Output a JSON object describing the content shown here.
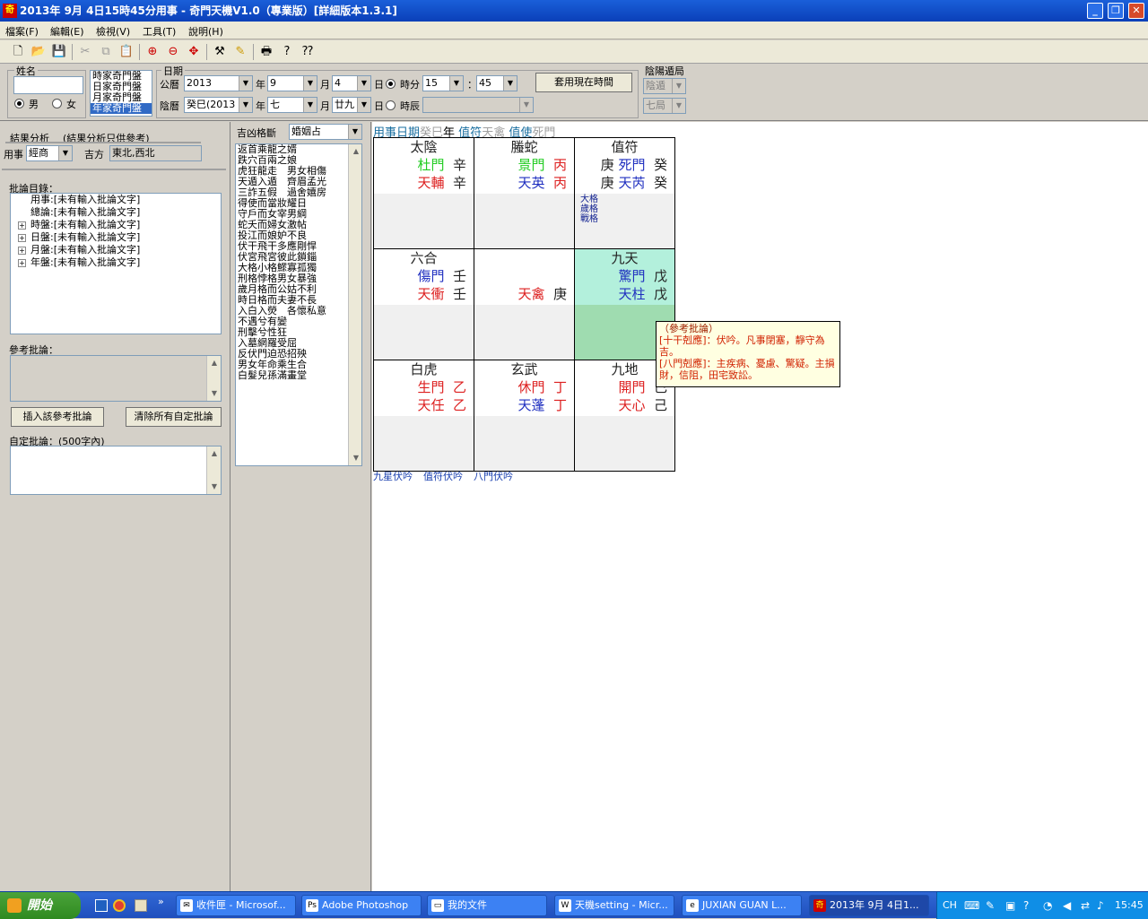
{
  "window": {
    "title": "2013年 9月 4日15時45分用事 - 奇門天機V1.0（專業版）[詳細版本1.3.1]",
    "icon": "qimen-app-icon",
    "minimize": "_",
    "restore": "❐",
    "close": "✕"
  },
  "menu": [
    {
      "label": "檔案(F)"
    },
    {
      "label": "編輯(E)"
    },
    {
      "label": "檢視(V)"
    },
    {
      "label": "工具(T)"
    },
    {
      "label": "說明(H)"
    }
  ],
  "toolbar": {
    "icons": [
      "new-file-icon",
      "open-folder-icon",
      "save-icon",
      "cut-icon",
      "copy-icon",
      "paste-icon",
      "zoom-in-icon",
      "zoom-out-icon",
      "compass-icon",
      "tool-icon",
      "highlight-icon",
      "print-icon",
      "help-icon",
      "context-help-icon"
    ]
  },
  "form": {
    "name_label": "姓名",
    "name_value": "",
    "male": "男",
    "female": "女",
    "chart_types": [
      "時家奇門盤",
      "日家奇門盤",
      "月家奇門盤",
      "年家奇門盤"
    ],
    "date_label": "日期",
    "solar_label": "公曆",
    "solar_year": "2013",
    "year_unit": "年",
    "solar_month": "9",
    "month_unit": "月",
    "solar_day": "4",
    "day_unit": "日",
    "hourmin_label": "時分",
    "hour": "15",
    "colon": "：",
    "minute": "45",
    "lunar_label": "陰曆",
    "lunar_year": "癸巳(2013",
    "lunar_month": "七",
    "lunar_day": "廿九",
    "shichen_label": "時辰",
    "shichen_value": "",
    "now_button": "套用現在時間",
    "yinyang_label": "陰陽遁局",
    "yinyang_value": "陰遁",
    "ju_value": "七局"
  },
  "left": {
    "analysis_title": "結果分析",
    "analysis_note": "(結果分析只供參考)",
    "yongshi_label": "用事",
    "yongshi_value": "經商",
    "jifang_label": "吉方",
    "jifang_value": "東北,西北",
    "comment_dir_label": "批論目錄：",
    "tree": [
      {
        "label": "用事:[未有輸入批論文字]"
      },
      {
        "label": "總論:[未有輸入批論文字]"
      },
      {
        "label": "時盤:[未有輸入批論文字]"
      },
      {
        "label": "日盤:[未有輸入批論文字]"
      },
      {
        "label": "月盤:[未有輸入批論文字]"
      },
      {
        "label": "年盤:[未有輸入批論文字]"
      }
    ],
    "ref_label": "參考批論：",
    "insert_button": "插入該參考批論",
    "clear_button": "清除所有自定批論",
    "custom_label": "自定批論：(500字內)"
  },
  "mid": {
    "judge_label": "吉凶格斷",
    "judge_value": "婚姻占",
    "patterns": [
      "返首乘龍之婿",
      "跌穴百兩之娘",
      "虎狂龍走　男女相傷",
      "天遁入遁　齊眉孟光",
      "三詐五假　過舍嬉房",
      "得使而當妝耀日",
      "守戶而女宰男綱",
      "蛇夭而婦女激帖",
      "投江而娘妒不良",
      "伏干飛干多應剛悍",
      "伏宮飛宮彼此鎖錙",
      "大格小格鰥寡孤獨",
      "刑格悖格男女暴強",
      "歲月格而公姑不利",
      "時日格而夫妻不長",
      "入白入熒　各懷私意",
      "不遇兮有變",
      "刑擊兮性狂",
      "入墓網羅受屈",
      "反伏門迫恐招殃",
      "男女年命乘生合",
      "白髮兒孫滿畫堂"
    ]
  },
  "board": {
    "header": [
      {
        "text": "用事日期",
        "color": "#1a6fa0",
        "underline": true
      },
      {
        "text": "癸巳",
        "color": "#a0a0a0"
      },
      {
        "text": "年",
        "color": "#000"
      },
      {
        "text": "  值符",
        "color": "#1a6fa0",
        "underline": true
      },
      {
        "text": "天禽",
        "color": "#a0a0a0"
      },
      {
        "text": "  值使",
        "color": "#1a6fa0",
        "underline": true
      },
      {
        "text": "死門",
        "color": "#a0a0a0"
      }
    ],
    "cells": [
      {
        "god": "太陰",
        "r1": [
          {
            "t": "杜門",
            "c": "#22cc22"
          },
          {
            "t": "辛",
            "c": "#222"
          }
        ],
        "r2": [
          {
            "t": "天輔",
            "c": "#dd2020"
          },
          {
            "t": "辛",
            "c": "#222"
          }
        ]
      },
      {
        "god": "螣蛇",
        "r1": [
          {
            "t": "景門",
            "c": "#22cc22"
          },
          {
            "t": "丙",
            "c": "#dd2020"
          }
        ],
        "r2": [
          {
            "t": "天英",
            "c": "#2030c0"
          },
          {
            "t": "丙",
            "c": "#dd2020"
          }
        ]
      },
      {
        "god": "值符",
        "left1": "庚",
        "left2": "庚",
        "r1": [
          {
            "t": "死門",
            "c": "#2030c0"
          },
          {
            "t": "癸",
            "c": "#222"
          }
        ],
        "r2": [
          {
            "t": "天芮",
            "c": "#2030c0"
          },
          {
            "t": "癸",
            "c": "#222"
          }
        ],
        "tags": [
          "大格",
          "歲格",
          "戰格"
        ]
      },
      {
        "god": "六合",
        "r1": [
          {
            "t": "傷門",
            "c": "#2030c0"
          },
          {
            "t": "壬",
            "c": "#222"
          }
        ],
        "r2": [
          {
            "t": "天衝",
            "c": "#dd2020"
          },
          {
            "t": "壬",
            "c": "#222"
          }
        ]
      },
      {
        "god": "",
        "r1": [],
        "r2": [
          {
            "t": "天禽",
            "c": "#dd2020"
          },
          {
            "t": "庚",
            "c": "#222"
          }
        ]
      },
      {
        "god": "九天",
        "r1": [
          {
            "t": "驚門",
            "c": "#2030c0"
          },
          {
            "t": "戊",
            "c": "#222"
          }
        ],
        "r2": [
          {
            "t": "天柱",
            "c": "#2030c0"
          },
          {
            "t": "戊",
            "c": "#222"
          }
        ],
        "hl": true
      },
      {
        "god": "白虎",
        "r1": [
          {
            "t": "生門",
            "c": "#dd2020"
          },
          {
            "t": "乙",
            "c": "#dd2020"
          }
        ],
        "r2": [
          {
            "t": "天任",
            "c": "#dd2020"
          },
          {
            "t": "乙",
            "c": "#dd2020"
          }
        ]
      },
      {
        "god": "玄武",
        "r1": [
          {
            "t": "休門",
            "c": "#dd2020"
          },
          {
            "t": "丁",
            "c": "#dd2020"
          }
        ],
        "r2": [
          {
            "t": "天蓬",
            "c": "#2030c0"
          },
          {
            "t": "丁",
            "c": "#dd2020"
          }
        ]
      },
      {
        "god": "九地",
        "r1": [
          {
            "t": "開門",
            "c": "#dd2020"
          },
          {
            "t": "己",
            "c": "#222"
          }
        ],
        "r2": [
          {
            "t": "天心",
            "c": "#dd2020"
          },
          {
            "t": "己",
            "c": "#222"
          }
        ]
      }
    ],
    "footer": [
      "九星伏吟",
      "值符伏吟",
      "八門伏吟"
    ],
    "tooltip": {
      "title": "（參考批論）",
      "line1": "[十干剋應]：伏吟。凡事閉塞，靜守為吉。",
      "line2": "[八門剋應]：主疾病、憂慮、驚疑。主損財，信阻，田宅致訟。"
    }
  },
  "taskbar": {
    "start": "開始",
    "quick": [
      "show-desktop-icon",
      "chrome-icon",
      "folder-icon",
      "more-icon"
    ],
    "tasks": [
      {
        "label": "收件匣 - Microsof...",
        "icon": "outlook-icon"
      },
      {
        "label": "Adobe Photoshop",
        "icon": "photoshop-icon"
      },
      {
        "label": "我的文件",
        "icon": "folder-icon"
      },
      {
        "label": "天機setting - Micr...",
        "icon": "word-icon"
      },
      {
        "label": "JUXIAN GUAN L...",
        "icon": "ie-icon"
      },
      {
        "label": "2013年 9月 4日1...",
        "icon": "qimen-app-icon",
        "active": true
      }
    ],
    "lang": "CH",
    "clock": "15:45"
  }
}
